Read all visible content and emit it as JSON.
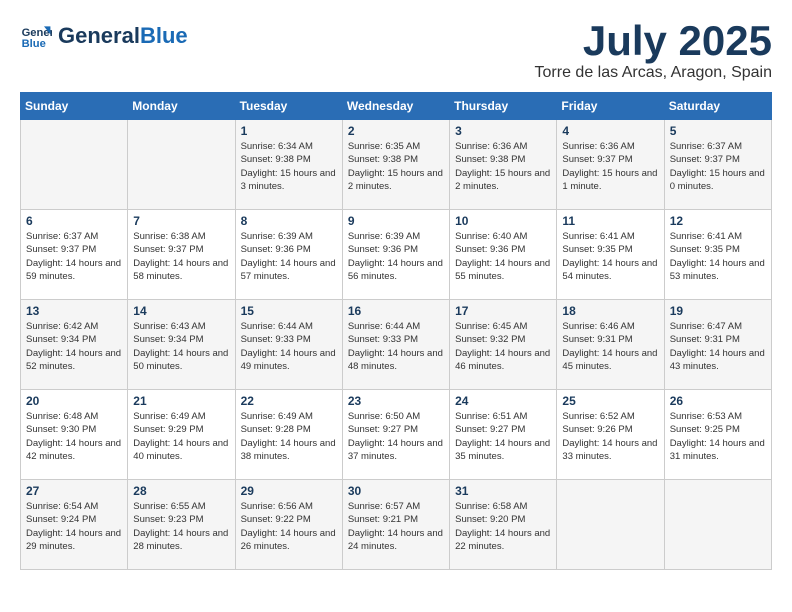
{
  "header": {
    "logo_line1": "General",
    "logo_line2": "Blue",
    "month_title": "July 2025",
    "location": "Torre de las Arcas, Aragon, Spain"
  },
  "weekdays": [
    "Sunday",
    "Monday",
    "Tuesday",
    "Wednesday",
    "Thursday",
    "Friday",
    "Saturday"
  ],
  "weeks": [
    [
      null,
      null,
      {
        "day": "1",
        "sunrise": "6:34 AM",
        "sunset": "9:38 PM",
        "daylight": "15 hours and 3 minutes."
      },
      {
        "day": "2",
        "sunrise": "6:35 AM",
        "sunset": "9:38 PM",
        "daylight": "15 hours and 2 minutes."
      },
      {
        "day": "3",
        "sunrise": "6:36 AM",
        "sunset": "9:38 PM",
        "daylight": "15 hours and 2 minutes."
      },
      {
        "day": "4",
        "sunrise": "6:36 AM",
        "sunset": "9:37 PM",
        "daylight": "15 hours and 1 minute."
      },
      {
        "day": "5",
        "sunrise": "6:37 AM",
        "sunset": "9:37 PM",
        "daylight": "15 hours and 0 minutes."
      }
    ],
    [
      {
        "day": "6",
        "sunrise": "6:37 AM",
        "sunset": "9:37 PM",
        "daylight": "14 hours and 59 minutes."
      },
      {
        "day": "7",
        "sunrise": "6:38 AM",
        "sunset": "9:37 PM",
        "daylight": "14 hours and 58 minutes."
      },
      {
        "day": "8",
        "sunrise": "6:39 AM",
        "sunset": "9:36 PM",
        "daylight": "14 hours and 57 minutes."
      },
      {
        "day": "9",
        "sunrise": "6:39 AM",
        "sunset": "9:36 PM",
        "daylight": "14 hours and 56 minutes."
      },
      {
        "day": "10",
        "sunrise": "6:40 AM",
        "sunset": "9:36 PM",
        "daylight": "14 hours and 55 minutes."
      },
      {
        "day": "11",
        "sunrise": "6:41 AM",
        "sunset": "9:35 PM",
        "daylight": "14 hours and 54 minutes."
      },
      {
        "day": "12",
        "sunrise": "6:41 AM",
        "sunset": "9:35 PM",
        "daylight": "14 hours and 53 minutes."
      }
    ],
    [
      {
        "day": "13",
        "sunrise": "6:42 AM",
        "sunset": "9:34 PM",
        "daylight": "14 hours and 52 minutes."
      },
      {
        "day": "14",
        "sunrise": "6:43 AM",
        "sunset": "9:34 PM",
        "daylight": "14 hours and 50 minutes."
      },
      {
        "day": "15",
        "sunrise": "6:44 AM",
        "sunset": "9:33 PM",
        "daylight": "14 hours and 49 minutes."
      },
      {
        "day": "16",
        "sunrise": "6:44 AM",
        "sunset": "9:33 PM",
        "daylight": "14 hours and 48 minutes."
      },
      {
        "day": "17",
        "sunrise": "6:45 AM",
        "sunset": "9:32 PM",
        "daylight": "14 hours and 46 minutes."
      },
      {
        "day": "18",
        "sunrise": "6:46 AM",
        "sunset": "9:31 PM",
        "daylight": "14 hours and 45 minutes."
      },
      {
        "day": "19",
        "sunrise": "6:47 AM",
        "sunset": "9:31 PM",
        "daylight": "14 hours and 43 minutes."
      }
    ],
    [
      {
        "day": "20",
        "sunrise": "6:48 AM",
        "sunset": "9:30 PM",
        "daylight": "14 hours and 42 minutes."
      },
      {
        "day": "21",
        "sunrise": "6:49 AM",
        "sunset": "9:29 PM",
        "daylight": "14 hours and 40 minutes."
      },
      {
        "day": "22",
        "sunrise": "6:49 AM",
        "sunset": "9:28 PM",
        "daylight": "14 hours and 38 minutes."
      },
      {
        "day": "23",
        "sunrise": "6:50 AM",
        "sunset": "9:27 PM",
        "daylight": "14 hours and 37 minutes."
      },
      {
        "day": "24",
        "sunrise": "6:51 AM",
        "sunset": "9:27 PM",
        "daylight": "14 hours and 35 minutes."
      },
      {
        "day": "25",
        "sunrise": "6:52 AM",
        "sunset": "9:26 PM",
        "daylight": "14 hours and 33 minutes."
      },
      {
        "day": "26",
        "sunrise": "6:53 AM",
        "sunset": "9:25 PM",
        "daylight": "14 hours and 31 minutes."
      }
    ],
    [
      {
        "day": "27",
        "sunrise": "6:54 AM",
        "sunset": "9:24 PM",
        "daylight": "14 hours and 29 minutes."
      },
      {
        "day": "28",
        "sunrise": "6:55 AM",
        "sunset": "9:23 PM",
        "daylight": "14 hours and 28 minutes."
      },
      {
        "day": "29",
        "sunrise": "6:56 AM",
        "sunset": "9:22 PM",
        "daylight": "14 hours and 26 minutes."
      },
      {
        "day": "30",
        "sunrise": "6:57 AM",
        "sunset": "9:21 PM",
        "daylight": "14 hours and 24 minutes."
      },
      {
        "day": "31",
        "sunrise": "6:58 AM",
        "sunset": "9:20 PM",
        "daylight": "14 hours and 22 minutes."
      },
      null,
      null
    ]
  ],
  "labels": {
    "sunrise": "Sunrise:",
    "sunset": "Sunset:",
    "daylight": "Daylight:"
  }
}
